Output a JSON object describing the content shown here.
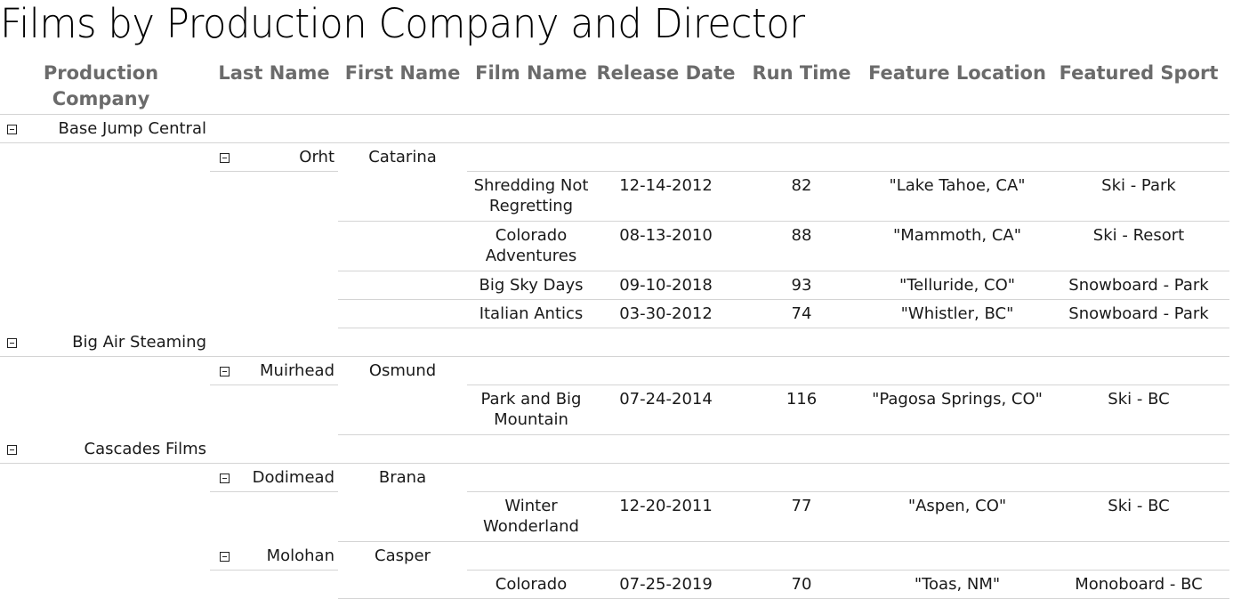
{
  "title": "Films by Production Company and Director",
  "columns": {
    "production_company_line1": "Production",
    "production_company_line2": "Company",
    "last_name": "Last Name",
    "first_name": "First Name",
    "film_name": "Film Name",
    "release_date": "Release Date",
    "run_time": "Run Time",
    "feature_location": "Feature Location",
    "featured_sport": "Featured Sport"
  },
  "groups": [
    {
      "company": "Base Jump Central",
      "directors": [
        {
          "last": "Orht",
          "first": "Catarina",
          "films": [
            {
              "name1": "Shredding Not",
              "name2": "Regretting",
              "date": "12-14-2012",
              "run": "82",
              "location": "\"Lake Tahoe, CA\"",
              "sport": "Ski - Park"
            },
            {
              "name1": "Colorado",
              "name2": "Adventures",
              "date": "08-13-2010",
              "run": "88",
              "location": "\"Mammoth, CA\"",
              "sport": "Ski - Resort"
            },
            {
              "name1": "Big Sky Days",
              "date": "09-10-2018",
              "run": "93",
              "location": "\"Telluride, CO\"",
              "sport": "Snowboard - Park"
            },
            {
              "name1": "Italian Antics",
              "date": "03-30-2012",
              "run": "74",
              "location": "\"Whistler, BC\"",
              "sport": "Snowboard - Park"
            }
          ]
        }
      ]
    },
    {
      "company": "Big Air Steaming",
      "directors": [
        {
          "last": "Muirhead",
          "first": "Osmund",
          "films": [
            {
              "name1": "Park and Big",
              "name2": "Mountain",
              "date": "07-24-2014",
              "run": "116",
              "location": "\"Pagosa Springs, CO\"",
              "sport": "Ski - BC"
            }
          ]
        }
      ]
    },
    {
      "company": "Cascades Films",
      "directors": [
        {
          "last": "Dodimead",
          "first": "Brana",
          "films": [
            {
              "name1": "Winter",
              "name2": "Wonderland",
              "date": "12-20-2011",
              "run": "77",
              "location": "\"Aspen, CO\"",
              "sport": "Ski - BC"
            }
          ]
        },
        {
          "last": "Molohan",
          "first": "Casper",
          "films": [
            {
              "name1": "Colorado",
              "date": "07-25-2019",
              "run": "70",
              "location": "\"Toas, NM\"",
              "sport": "Monoboard - BC"
            }
          ]
        }
      ]
    }
  ]
}
